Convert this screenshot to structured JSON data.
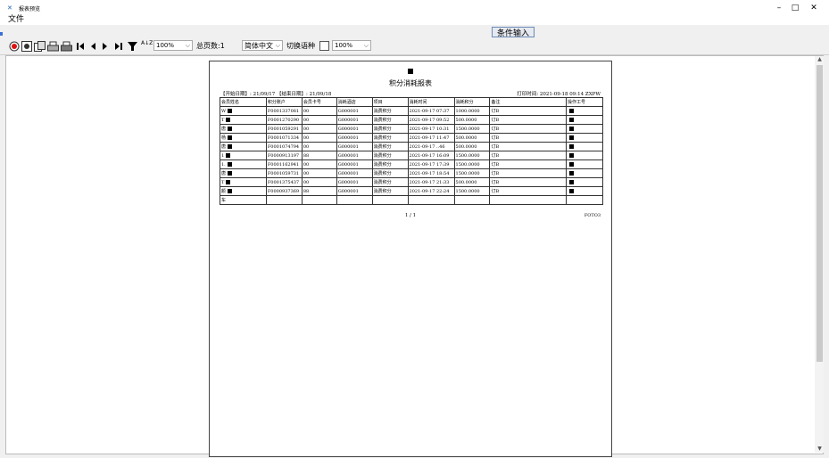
{
  "window": {
    "title": "报表预览",
    "minimize": "–",
    "maximize": "□",
    "close": "✕"
  },
  "menu": {
    "file": "文件"
  },
  "condition_button": "条件输入",
  "toolbar": {
    "zoom": "100%",
    "total_pages_label": "总页数:1",
    "language": "简体中文",
    "switch_language_label": "切换语种",
    "zoom2": "100%",
    "sort_glyph": "A↓Z"
  },
  "report": {
    "title": "积分消耗报表",
    "date_range": "【开始日期】: 21/09/17 【结束日期】: 21/09/18",
    "print_time": "打印时间: 2021-09-18 09:14 ZXPW",
    "columns": [
      "会员姓名",
      "积分账户",
      "会员卡号",
      "消耗酒店",
      "项目",
      "消耗时间",
      "消耗积分",
      "备注",
      "操作工号"
    ],
    "rows": [
      [
        "W",
        "F0001337081",
        "00",
        "G000001",
        "消费积分",
        "2021-09-17 07:37",
        "1000.0000",
        "订B",
        ""
      ],
      [
        "T",
        "F0001270290",
        "00",
        "G000001",
        "消费积分",
        "2021-09-17 09:52",
        "500.0000",
        "订B",
        ""
      ],
      [
        "唐",
        "F0001059291",
        "00",
        "G000001",
        "消费积分",
        "2021-09-17 10:31",
        "1500.0000",
        "订B",
        ""
      ],
      [
        "杨",
        "F0001071334",
        "00",
        "G000001",
        "消费积分",
        "2021-09-17 11:47",
        "500.0000",
        "订B",
        ""
      ],
      [
        "唐",
        "F0001074794",
        "00",
        "G000001",
        "消费积分",
        "2021-09-17 ..46",
        "500.0000",
        "订B",
        ""
      ],
      [
        "1",
        "F0000913197",
        "88",
        "G000001",
        "消费积分",
        "2021-09-17 16:09",
        "1500.0000",
        "订B",
        ""
      ],
      [
        "1.",
        "F0001162941",
        "00",
        "G000001",
        "消费积分",
        "2021-09-17 17:39",
        "1500.0000",
        "订B",
        ""
      ],
      [
        "唐",
        "F0001059731",
        "00",
        "G000001",
        "消费积分",
        "2021-09-17 18:54",
        "1500.0000",
        "订B",
        ""
      ],
      [
        "T",
        "F0001375437",
        "00",
        "G000001",
        "消费积分",
        "2021-09-17 21:33",
        "500.0000",
        "订B",
        ""
      ],
      [
        "颜",
        "F0000937369",
        "88",
        "G000001",
        "消费积分",
        "2021-09-17 22:24",
        "1500.0000",
        "订B",
        ""
      ],
      [
        "车",
        "",
        "",
        "",
        "",
        "",
        "",
        "",
        ""
      ]
    ],
    "page": "1 / 1",
    "page_code": "FOTO3"
  }
}
